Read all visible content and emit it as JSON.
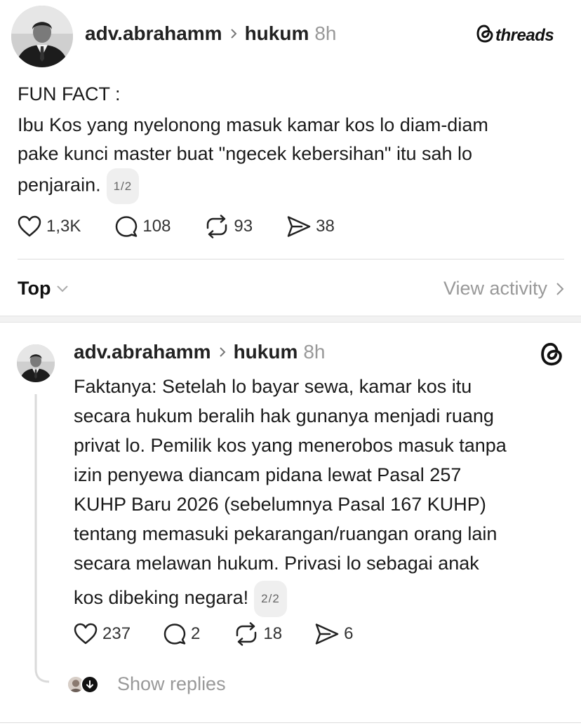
{
  "brand": {
    "label": "threads"
  },
  "post1": {
    "username": "adv.abrahamm",
    "topic": "hukum",
    "time": "8h",
    "lines": [
      "FUN FACT :",
      "Ibu Kos yang nyelonong masuk kamar kos lo diam-diam",
      "pake kunci master buat \"ngecek kebersihan\" itu sah lo",
      "penjarain."
    ],
    "page_indicator": "1/2",
    "likes": "1,3K",
    "comments": "108",
    "reposts": "93",
    "shares": "38"
  },
  "sort": {
    "label": "Top",
    "view_activity": "View activity"
  },
  "post2": {
    "username": "adv.abrahamm",
    "topic": "hukum",
    "time": "8h",
    "lines": [
      "Faktanya: Setelah lo bayar sewa, kamar kos itu",
      "secara hukum beralih hak gunanya menjadi ruang",
      "privat lo. Pemilik kos yang menerobos masuk tanpa",
      "izin penyewa diancam pidana lewat Pasal 257",
      "KUHP Baru 2026 (sebelumnya Pasal 167 KUHP)",
      "tentang memasuki pekarangan/ruangan orang lain",
      "secara melawan hukum. Privasi lo sebagai anak",
      "kos dibeking negara!"
    ],
    "page_indicator": "2/2",
    "likes": "237",
    "comments": "2",
    "reposts": "18",
    "shares": "6"
  },
  "replies": {
    "label": "Show replies"
  },
  "icons": {
    "chevron": "chevron-right-icon",
    "heart": "heart-icon",
    "comment": "comment-icon",
    "repost": "repost-icon",
    "share": "share-icon",
    "threads_logo": "threads-logo-icon"
  }
}
